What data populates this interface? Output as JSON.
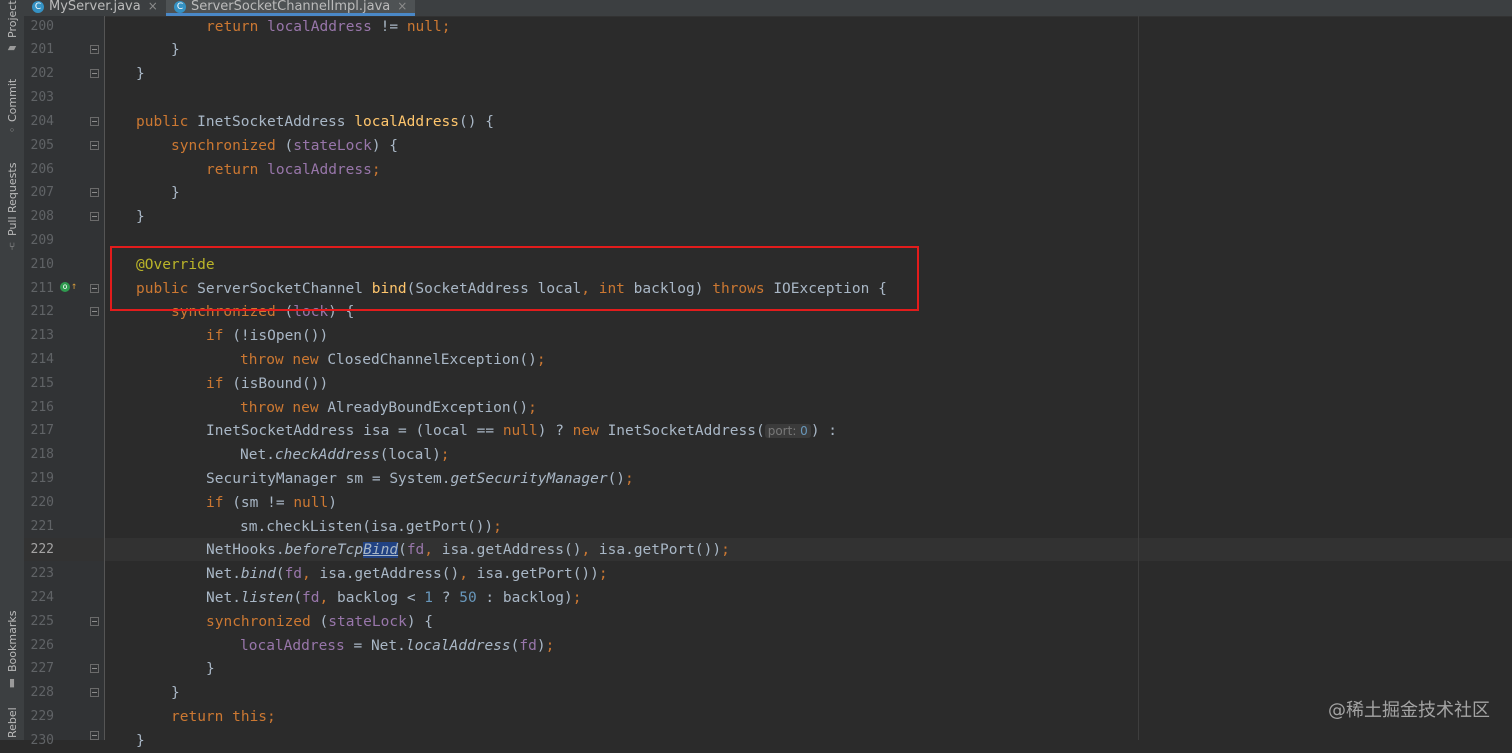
{
  "tabs": [
    {
      "label": "MyServer.java",
      "active": false
    },
    {
      "label": "ServerSocketChannelImpl.java",
      "active": true
    }
  ],
  "tool_windows": [
    "Project",
    "Commit",
    "Pull Requests",
    "Bookmarks",
    "Rebel"
  ],
  "editor": {
    "current_line": "222",
    "lines": [
      {
        "n": "200"
      },
      {
        "n": "201"
      },
      {
        "n": "202"
      },
      {
        "n": "203"
      },
      {
        "n": "204"
      },
      {
        "n": "205"
      },
      {
        "n": "206"
      },
      {
        "n": "207"
      },
      {
        "n": "208"
      },
      {
        "n": "209"
      },
      {
        "n": "210"
      },
      {
        "n": "211"
      },
      {
        "n": "212"
      },
      {
        "n": "213"
      },
      {
        "n": "214"
      },
      {
        "n": "215"
      },
      {
        "n": "216"
      },
      {
        "n": "217"
      },
      {
        "n": "218"
      },
      {
        "n": "219"
      },
      {
        "n": "220"
      },
      {
        "n": "221"
      },
      {
        "n": "222"
      },
      {
        "n": "223"
      },
      {
        "n": "224"
      },
      {
        "n": "225"
      },
      {
        "n": "226"
      },
      {
        "n": "227"
      },
      {
        "n": "228"
      },
      {
        "n": "229"
      },
      {
        "n": "230"
      }
    ],
    "code_tokens": {
      "l200": [
        "return",
        " localAddress",
        " != ",
        "null",
        ";"
      ],
      "l201": "}",
      "l202": "}",
      "l204": [
        "public ",
        "InetSocketAddress ",
        "localAddress",
        "() {"
      ],
      "l205": [
        "synchronized ",
        "(",
        "stateLock",
        ") {"
      ],
      "l206": [
        "return ",
        "localAddress",
        ";"
      ],
      "l207": "}",
      "l208": "}",
      "l210": "@Override",
      "l211": [
        "public ",
        "ServerSocketChannel ",
        "bind",
        "(SocketAddress local",
        ", ",
        "int ",
        "backlog) ",
        "throws ",
        "IOException {"
      ],
      "l212": [
        "synchronized ",
        "(",
        "lock",
        ") {"
      ],
      "l213": [
        "if ",
        "(!isOpen())"
      ],
      "l214": [
        "throw ",
        "new ",
        "ClosedChannelException()",
        ";"
      ],
      "l215": [
        "if ",
        "(isBound())"
      ],
      "l216": [
        "throw ",
        "new ",
        "AlreadyBoundException()",
        ";"
      ],
      "l217": [
        "InetSocketAddress isa = (local == ",
        "null",
        ") ? ",
        "new ",
        "InetSocketAddress(",
        "port:",
        " 0",
        ") :"
      ],
      "l218": [
        "Net.",
        "checkAddress",
        "(local)",
        ";"
      ],
      "l219": [
        "SecurityManager sm = System.",
        "getSecurityManager",
        "()",
        ";"
      ],
      "l220": [
        "if ",
        "(sm != ",
        "null",
        ")"
      ],
      "l221": [
        "sm.checkListen(isa.getPort())",
        ";"
      ],
      "l222": [
        "NetHooks.",
        "beforeTcp",
        "Bind",
        "(",
        "fd",
        ", ",
        "isa.getAddress()",
        ", ",
        "isa.getPort())",
        ";"
      ],
      "l223": [
        "Net.",
        "bind",
        "(",
        "fd",
        ", ",
        "isa.getAddress()",
        ", ",
        "isa.getPort())",
        ";"
      ],
      "l224": [
        "Net.",
        "listen",
        "(",
        "fd",
        ", ",
        "backlog < ",
        "1",
        " ? ",
        "50",
        " : backlog)",
        ";"
      ],
      "l225": [
        "synchronized ",
        "(",
        "stateLock",
        ") {"
      ],
      "l226": [
        "localAddress",
        " = Net.",
        "localAddress",
        "(",
        "fd",
        ")",
        ";"
      ],
      "l227": "}",
      "l228": "}",
      "l229": [
        "return ",
        "this",
        ";"
      ],
      "l230": "}"
    }
  },
  "watermark": "@稀土掘金技术社区",
  "colors": {
    "keyword": "#cc7832",
    "method": "#ffc66d",
    "annotation": "#bbb529",
    "field": "#9876aa",
    "number": "#6897bb",
    "text": "#a9b7c6",
    "highlight_box": "#e21c1c"
  }
}
